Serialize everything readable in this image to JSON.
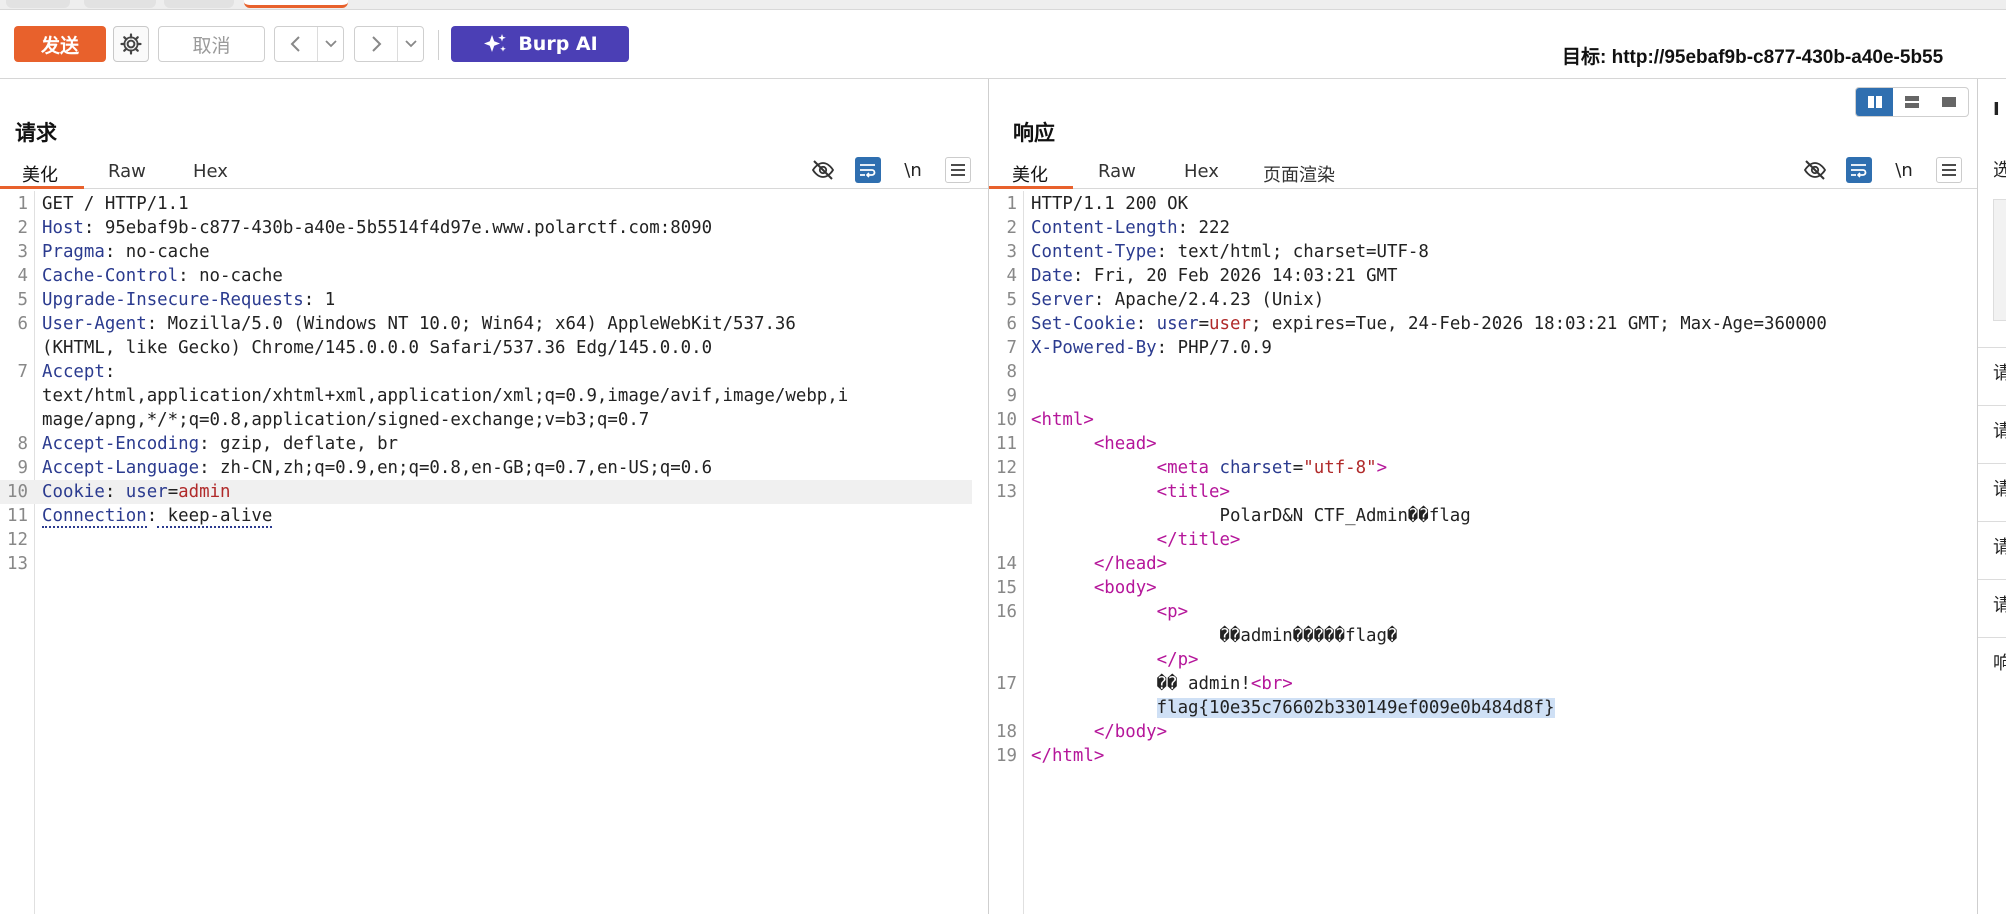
{
  "toolbar": {
    "send_label": "发送",
    "cancel_label": "取消",
    "burp_ai_label": "Burp AI",
    "target_label": "目标: http://95ebaf9b-c877-430b-a40e-5b55"
  },
  "request": {
    "title": "请求",
    "tabs": [
      "美化",
      "Raw",
      "Hex"
    ],
    "lines": [
      {
        "n": "1",
        "key": "",
        "val": "GET / HTTP/1.1"
      },
      {
        "n": "2",
        "key": "Host",
        "val": " 95ebaf9b-c877-430b-a40e-5b5514f4d97e.www.polarctf.com:8090"
      },
      {
        "n": "3",
        "key": "Pragma",
        "val": " no-cache"
      },
      {
        "n": "4",
        "key": "Cache-Control",
        "val": " no-cache"
      },
      {
        "n": "5",
        "key": "Upgrade-Insecure-Requests",
        "val": " 1"
      },
      {
        "n": "6",
        "key": "User-Agent",
        "val": " Mozilla/5.0 (Windows NT 10.0; Win64; x64) AppleWebKit/537.36"
      },
      {
        "n": "",
        "key": "",
        "val": "(KHTML, like Gecko) Chrome/145.0.0.0 Safari/537.36 Edg/145.0.0.0"
      },
      {
        "n": "7",
        "key": "Accept",
        "val": ""
      },
      {
        "n": "",
        "key": "",
        "val": "text/html,application/xhtml+xml,application/xml;q=0.9,image/avif,image/webp,i"
      },
      {
        "n": "",
        "key": "",
        "val": "mage/apng,*/*;q=0.8,application/signed-exchange;v=b3;q=0.7"
      },
      {
        "n": "8",
        "key": "Accept-Encoding",
        "val": " gzip, deflate, br"
      },
      {
        "n": "9",
        "key": "Accept-Language",
        "val": " zh-CN,zh;q=0.9,en;q=0.8,en-GB;q=0.7,en-US;q=0.6"
      },
      {
        "n": "10",
        "key": "Cookie",
        "val": " ",
        "ck": "user",
        "cv": "admin"
      },
      {
        "n": "11",
        "key": "Connection",
        "val": " keep-alive"
      },
      {
        "n": "12",
        "key": "",
        "val": ""
      },
      {
        "n": "13",
        "key": "",
        "val": ""
      }
    ]
  },
  "response": {
    "title": "响应",
    "tabs": [
      "美化",
      "Raw",
      "Hex",
      "页面渲染"
    ],
    "lines": [
      {
        "n": "1",
        "t": "plain",
        "text": "HTTP/1.1 200 OK"
      },
      {
        "n": "2",
        "t": "hdr",
        "key": "Content-Length",
        "val": " 222"
      },
      {
        "n": "3",
        "t": "hdr",
        "key": "Content-Type",
        "val": " text/html; charset=UTF-8"
      },
      {
        "n": "4",
        "t": "hdr",
        "key": "Date",
        "val": " Fri, 20 Feb 2026 14:03:21 GMT"
      },
      {
        "n": "5",
        "t": "hdr",
        "key": "Server",
        "val": " Apache/2.4.23 (Unix)"
      },
      {
        "n": "6",
        "t": "cookie",
        "key": "Set-Cookie",
        "pre": " ",
        "ck": "user",
        "cv": "user",
        "post": "; expires=Tue, 24-Feb-2026 18:03:21 GMT; Max-Age=360000"
      },
      {
        "n": "7",
        "t": "hdr",
        "key": "X-Powered-By",
        "val": " PHP/7.0.9"
      },
      {
        "n": "8",
        "t": "plain",
        "text": ""
      },
      {
        "n": "9",
        "t": "plain",
        "text": ""
      },
      {
        "n": "10",
        "t": "tag",
        "indent": "",
        "text": "<html>"
      },
      {
        "n": "11",
        "t": "tag",
        "indent": "      ",
        "text": "<head>"
      },
      {
        "n": "12",
        "t": "meta",
        "indent": "            "
      },
      {
        "n": "13",
        "t": "tag",
        "indent": "            ",
        "text": "<title>"
      },
      {
        "n": "",
        "t": "plain",
        "indent": "                  ",
        "text": "PolarD&N CTF_Admin��flag"
      },
      {
        "n": "",
        "t": "tag",
        "indent": "            ",
        "text": "</title>"
      },
      {
        "n": "14",
        "t": "tag",
        "indent": "      ",
        "text": "</head>"
      },
      {
        "n": "15",
        "t": "tag",
        "indent": "      ",
        "text": "<body>"
      },
      {
        "n": "16",
        "t": "tag",
        "indent": "            ",
        "text": "<p>"
      },
      {
        "n": "",
        "t": "plain",
        "indent": "                  ",
        "text": "��admin�����flag�"
      },
      {
        "n": "",
        "t": "tag",
        "indent": "            ",
        "text": "</p>"
      },
      {
        "n": "17",
        "t": "br",
        "indent": "            ",
        "text": "�� admin!"
      },
      {
        "n": "",
        "t": "sel",
        "indent": "            ",
        "text": "flag{10e35c76602b330149ef009e0b484d8f}"
      },
      {
        "n": "18",
        "t": "tag",
        "indent": "      ",
        "text": "</body>"
      },
      {
        "n": "19",
        "t": "tag",
        "indent": "",
        "text": "</html>"
      }
    ],
    "meta": {
      "tag": "meta",
      "attr": "charset",
      "value": "\"utf-8\""
    }
  },
  "right_panel": {
    "labels": [
      "I",
      "选",
      "请",
      "请",
      "请",
      "请",
      "请",
      "响"
    ]
  },
  "colors": {
    "send": "#e8612c",
    "burp_ai": "#4b3fb5",
    "active_toggle": "#2f6fb0"
  }
}
